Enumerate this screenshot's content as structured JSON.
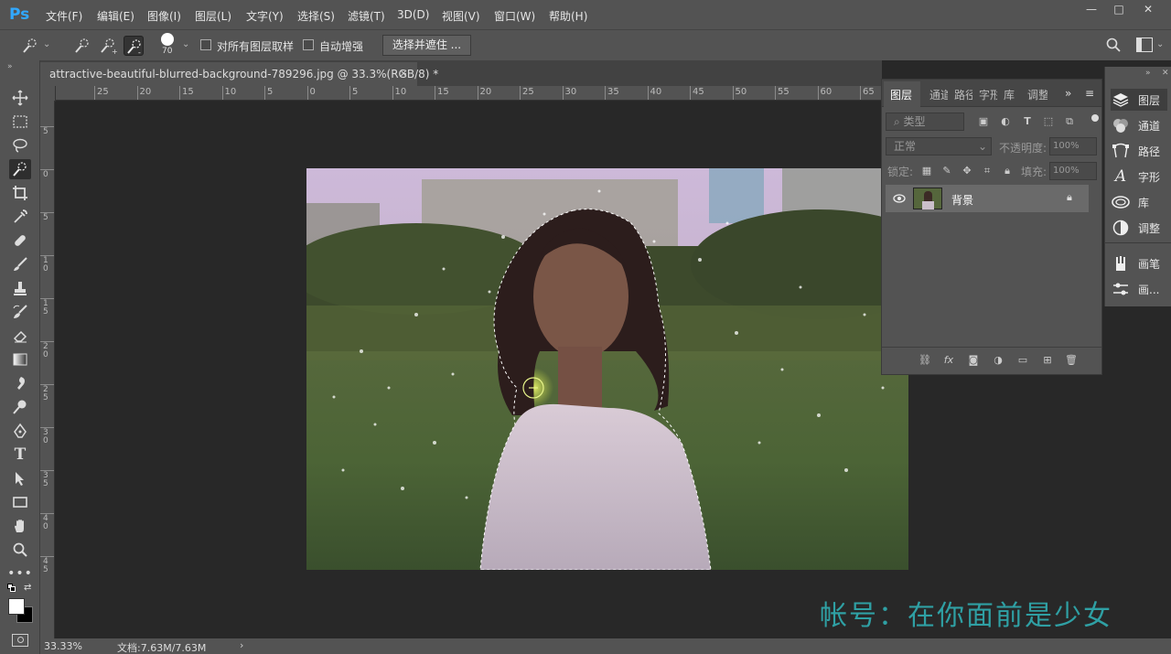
{
  "app": {
    "logo": "Ps"
  },
  "menu": [
    "文件(F)",
    "编辑(E)",
    "图像(I)",
    "图层(L)",
    "文字(Y)",
    "选择(S)",
    "滤镜(T)",
    "3D(D)",
    "视图(V)",
    "窗口(W)",
    "帮助(H)"
  ],
  "window_controls": {
    "minimize": "—",
    "maximize": "□",
    "close": "✕"
  },
  "options": {
    "brush_size": "70",
    "sample_all_layers": "对所有图层取样",
    "auto_enhance": "自动增强",
    "refine_button": "选择并遮住 ..."
  },
  "document": {
    "tab_title": "attractive-beautiful-blurred-background-789296.jpg @ 33.3%(RGB/8) *",
    "tab_close": "×"
  },
  "ruler_h": [
    "25",
    "20",
    "15",
    "10",
    "5",
    "0",
    "5",
    "10",
    "15",
    "20",
    "25",
    "30",
    "35",
    "40",
    "45",
    "50",
    "55",
    "60",
    "65"
  ],
  "ruler_v": [
    "5",
    "0",
    "5",
    "10",
    "15",
    "20",
    "25",
    "30",
    "35",
    "40",
    "45"
  ],
  "status": {
    "zoom": "33.33%",
    "doc_info": "文档:7.63M/7.63M",
    "arrow": "›"
  },
  "layers_panel": {
    "tabs": [
      "图层",
      "通道",
      "路径",
      "字形",
      "库",
      "调整"
    ],
    "menu_glyph": "≡",
    "collapse_glyph": "»",
    "filter_kind": "类型",
    "blend_mode": "正常",
    "opacity_label": "不透明度:",
    "opacity_value": "100%",
    "lock_label": "锁定:",
    "fill_label": "填充:",
    "fill_value": "100%",
    "layer_name": "背景"
  },
  "dock": {
    "items": [
      {
        "label": "图层",
        "icon": "layers-icon"
      },
      {
        "label": "通道",
        "icon": "channels-icon"
      },
      {
        "label": "路径",
        "icon": "paths-icon"
      },
      {
        "label": "字形",
        "icon": "glyphs-icon"
      },
      {
        "label": "库",
        "icon": "libraries-icon"
      },
      {
        "label": "调整",
        "icon": "adjustments-icon"
      },
      {
        "label": "画笔",
        "icon": "brushes-icon"
      },
      {
        "label": "画...",
        "icon": "brush-settings-icon"
      }
    ]
  },
  "watermark": "帐号：在你面前是少女",
  "colors": {
    "panel": "#535353",
    "canvas_bg": "#282828",
    "accent": "#31a8ff",
    "watermark": "#2fa0a4"
  }
}
